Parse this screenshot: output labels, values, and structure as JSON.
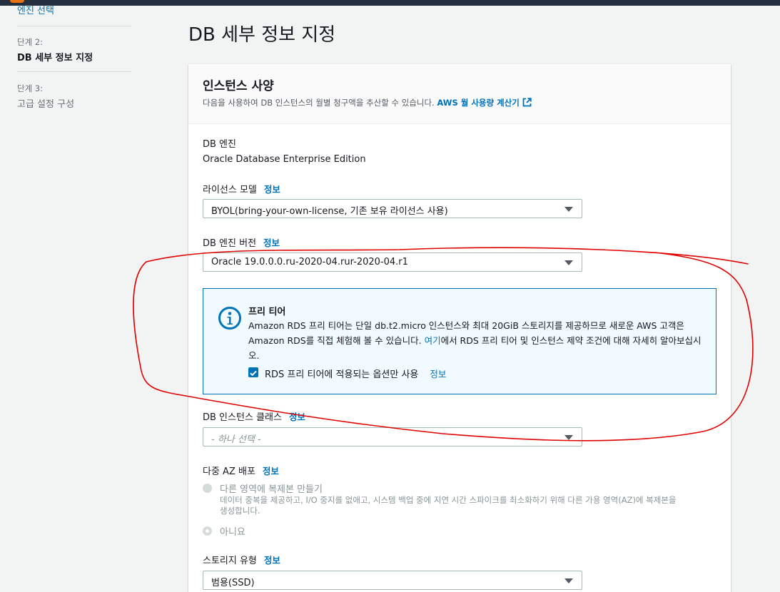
{
  "nav": {
    "step1_link": "엔진 선택",
    "step2_num": "단계 2:",
    "step2_title": "DB 세부 정보 지정",
    "step3_num": "단계 3:",
    "step3_title": "고급 설정 구성"
  },
  "page": {
    "title": "DB 세부 정보 지정"
  },
  "card": {
    "title": "인스턴스 사양",
    "desc": "다음을 사용하여 DB 인스턴스의 월별 청구액을 추산할 수 있습니다.",
    "calc_link": "AWS 월 사용량 계산기"
  },
  "db_engine": {
    "label": "DB 엔진",
    "value": "Oracle Database Enterprise Edition"
  },
  "license": {
    "label": "라이선스 모델",
    "info": "정보",
    "selected": "BYOL(bring-your-own-license, 기존 보유 라이선스 사용)"
  },
  "engine_version": {
    "label": "DB 엔진 버전",
    "info": "정보",
    "selected": "Oracle 19.0.0.0.ru-2020-04.rur-2020-04.r1"
  },
  "free_tier": {
    "title": "프리 티어",
    "body_before": "Amazon RDS 프리 티어는 단일 db.t2.micro 인스턴스와 최대 20GiB 스토리지를 제공하므로 새로운 AWS 고객은 Amazon RDS를 직접 체험해 볼 수 있습니다. ",
    "body_link": "여기",
    "body_after": "에서 RDS 프리 티어 및 인스턴스 제약 조건에 대해 자세히 알아보십시오.",
    "checkbox_label": "RDS 프리 티어에 적용되는 옵션만 사용",
    "info": "정보",
    "checked": true
  },
  "instance_class": {
    "label": "DB 인스턴스 클래스",
    "info": "정보",
    "placeholder": "- 하나 선택 -"
  },
  "multi_az": {
    "label": "다중 AZ 배포",
    "info": "정보",
    "option1": "다른 영역에 복제본 만들기",
    "option1_desc": "데이터 중복을 제공하고, I/O 중지를 없애고, 시스템 백업 중에 지연 시간 스파이크를 최소화하기 위해 다른 가용 영역(AZ)에 복제본을 생성합니다.",
    "option2": "아니요"
  },
  "storage_type": {
    "label": "스토리지 유형",
    "info": "정보",
    "selected": "범용(SSD)"
  },
  "colors": {
    "accent": "#0073bb",
    "annotation": "#e00000",
    "header": "#232f3e"
  },
  "icons": [
    "info-circle-icon",
    "external-link-icon",
    "checkmark-icon",
    "caret-down-icon"
  ]
}
